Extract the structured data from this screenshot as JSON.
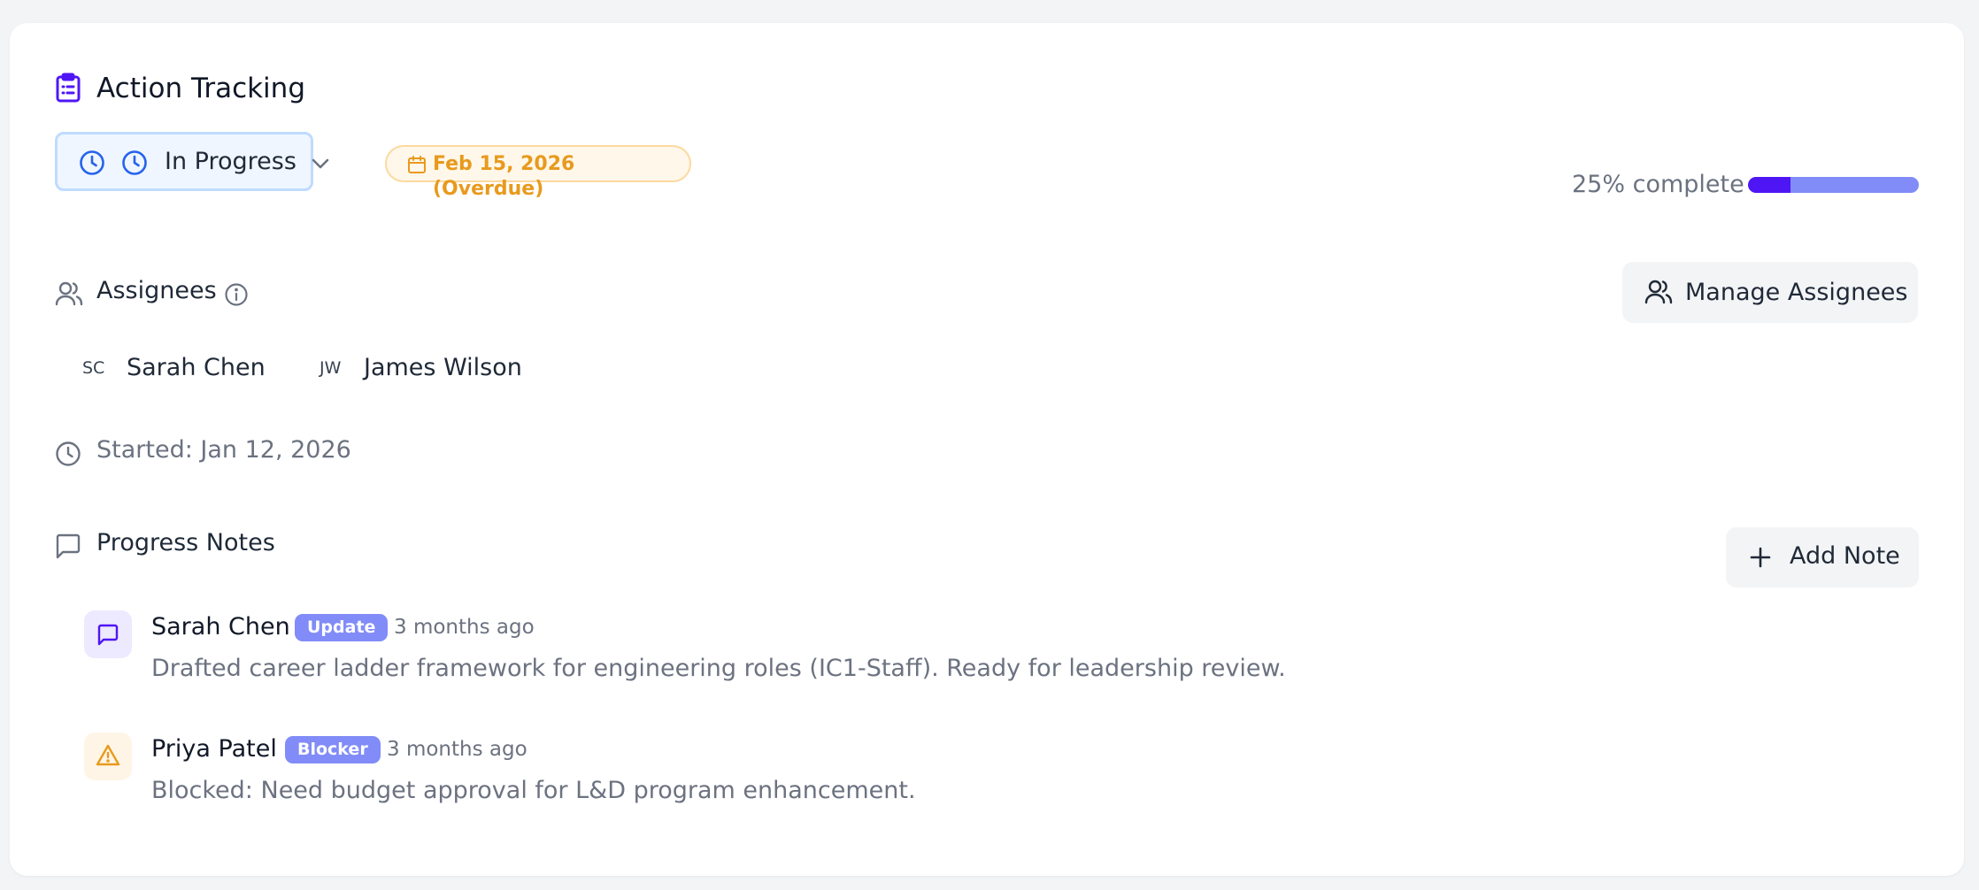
{
  "header": {
    "title": "Action Tracking",
    "title_icon": "clipboard-list-icon"
  },
  "status": {
    "value": "In Progress",
    "icon": "clock-icon"
  },
  "due": {
    "label": "Feb 15, 2026 (Overdue)",
    "icon": "calendar-icon",
    "color": "#e89a1d"
  },
  "progress": {
    "label": "25% complete",
    "percent": 25,
    "colors": {
      "fill": "#4f16f5",
      "track": "#818cf8"
    }
  },
  "assignees": {
    "label": "Assignees",
    "manage_label": "Manage Assignees",
    "people": [
      {
        "initials": "SC",
        "name": "Sarah Chen"
      },
      {
        "initials": "JW",
        "name": "James Wilson"
      }
    ]
  },
  "started": {
    "label": "Started: Jan 12, 2026"
  },
  "notes": {
    "label": "Progress Notes",
    "add_label": "Add Note",
    "items": [
      {
        "author": "Sarah Chen",
        "tag": "Update",
        "time": "3 months ago",
        "text": "Drafted career ladder framework for engineering roles (IC1-Staff). Ready for leadership review.",
        "icon": "message-square-icon"
      },
      {
        "author": "Priya Patel",
        "tag": "Blocker",
        "time": "3 months ago",
        "text": "Blocked: Need budget approval for L&D program enhancement.",
        "icon": "alert-triangle-icon"
      }
    ]
  }
}
